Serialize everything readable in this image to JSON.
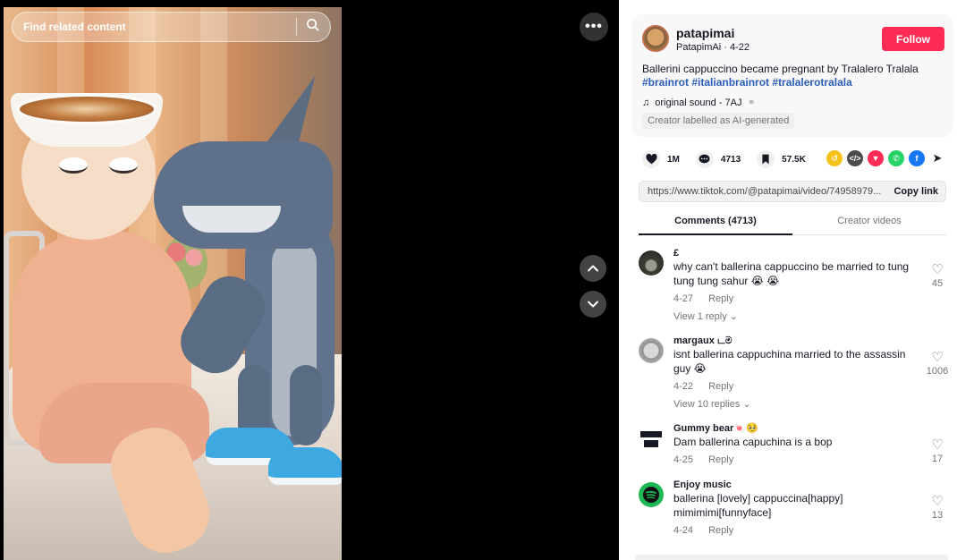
{
  "search": {
    "placeholder": "Find related content"
  },
  "author": {
    "name": "patapimai",
    "handle": "PatapimAi",
    "date": "4-22",
    "follow_label": "Follow"
  },
  "description": {
    "text": "Ballerini cappuccino became pregnant by Tralalero Tralala",
    "hashtags": [
      "#brainrot",
      "#italianbrainrot",
      "#tralalerotralala"
    ]
  },
  "sound": {
    "label": "original sound - 7AJ"
  },
  "ai_label": "Creator labelled as AI-generated",
  "stats": {
    "likes": "1M",
    "comments": "4713",
    "saves": "57.5K"
  },
  "share_icons": [
    "embed-icon",
    "code-icon",
    "send-icon",
    "whatsapp-icon",
    "facebook-icon",
    "share-arrow-icon"
  ],
  "link": {
    "url": "https://www.tiktok.com/@patapimai/video/74958979...",
    "copy_label": "Copy link"
  },
  "tabs": [
    {
      "label": "Comments (4713)"
    },
    {
      "label": "Creator videos"
    }
  ],
  "comments": [
    {
      "user": "£",
      "text": "why can't ballerina cappuccino be married to tung tung tung sahur 😭 😭",
      "date": "4-27",
      "reply_label": "Reply",
      "replies": "View 1 reply ⌄",
      "likes": "45"
    },
    {
      "user": "margaux டම",
      "text": "isnt ballerina cappuchina married to the assassin guy 😭",
      "date": "4-22",
      "reply_label": "Reply",
      "replies": "View 10 replies ⌄",
      "likes": "1006"
    },
    {
      "user": "Gummy bear🍬🥺",
      "text": "Dam ballerina capuchina is a bop",
      "date": "4-25",
      "reply_label": "Reply",
      "likes": "17"
    },
    {
      "user": "Enjoy music",
      "text": "ballerina [lovely] cappuccina[happy] mimimimi[funnyface]",
      "date": "4-24",
      "reply_label": "Reply",
      "likes": "13"
    }
  ],
  "colors": {
    "accent": "#fe2c55",
    "hashtag": "#2b5db9",
    "muted": "#737373"
  }
}
